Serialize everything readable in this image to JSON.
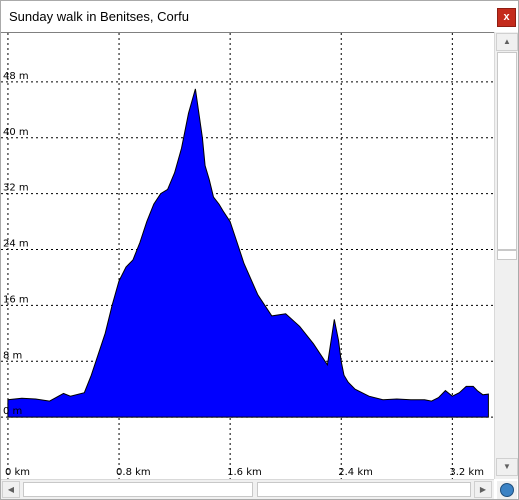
{
  "window": {
    "title": "Sunday walk in Benitses, Corfu",
    "close_label": "x"
  },
  "colors": {
    "fill": "#0000ff",
    "outline": "#000000",
    "grid": "#000000",
    "close": "#c42b1c"
  },
  "icons": {
    "close": "close-icon",
    "corner": "globe-icon",
    "scroll_up": "arrow-up-icon",
    "scroll_down": "arrow-down-icon",
    "scroll_left": "arrow-left-icon",
    "scroll_right": "arrow-right-icon"
  },
  "chart_data": {
    "type": "area",
    "title": "Sunday walk in Benitses, Corfu",
    "x_unit": "km",
    "y_unit": "m",
    "grid": true,
    "xlim": [
      -0.05,
      3.5
    ],
    "ylim": [
      -9,
      55
    ],
    "x_ticks": [
      0,
      0.8,
      1.6,
      2.4,
      3.2
    ],
    "x_tick_labels": [
      "0 km",
      "0.8 km",
      "1.6 km",
      "2.4 km",
      "3.2 km"
    ],
    "y_ticks": [
      0,
      8,
      16,
      24,
      32,
      40,
      48
    ],
    "y_tick_labels": [
      "0 m",
      "8 m",
      "16 m",
      "24 m",
      "32 m",
      "40 m",
      "48 m"
    ],
    "series": [
      {
        "x": [
          0.0,
          0.1,
          0.2,
          0.3,
          0.4,
          0.45,
          0.55,
          0.6,
          0.7,
          0.75,
          0.8,
          0.85,
          0.9,
          0.95,
          1.0,
          1.05,
          1.1,
          1.15,
          1.2,
          1.25,
          1.3,
          1.35,
          1.4,
          1.42,
          1.45,
          1.48,
          1.52,
          1.55,
          1.6,
          1.65,
          1.7,
          1.8,
          1.9,
          2.0,
          2.1,
          2.2,
          2.3,
          2.35,
          2.38,
          2.4,
          2.42,
          2.45,
          2.5,
          2.6,
          2.7,
          2.8,
          2.9,
          3.0,
          3.05,
          3.1,
          3.15,
          3.2,
          3.25,
          3.3,
          3.35,
          3.38,
          3.42,
          3.46
        ],
        "y": [
          2.5,
          2.7,
          2.6,
          2.3,
          3.4,
          3.0,
          3.5,
          6.0,
          12.0,
          16.0,
          19.5,
          21.5,
          22.5,
          25.0,
          28.0,
          30.5,
          32.0,
          32.6,
          35.0,
          38.5,
          43.5,
          47.0,
          40.0,
          36.0,
          34.0,
          31.5,
          30.5,
          29.5,
          28.0,
          25.0,
          22.0,
          17.5,
          14.5,
          14.8,
          13.0,
          10.5,
          7.5,
          14.0,
          11.0,
          8.0,
          6.0,
          5.0,
          4.0,
          3.0,
          2.5,
          2.6,
          2.5,
          2.5,
          2.3,
          2.8,
          3.8,
          3.0,
          3.5,
          4.4,
          4.4,
          3.8,
          3.2,
          3.3
        ]
      }
    ]
  }
}
